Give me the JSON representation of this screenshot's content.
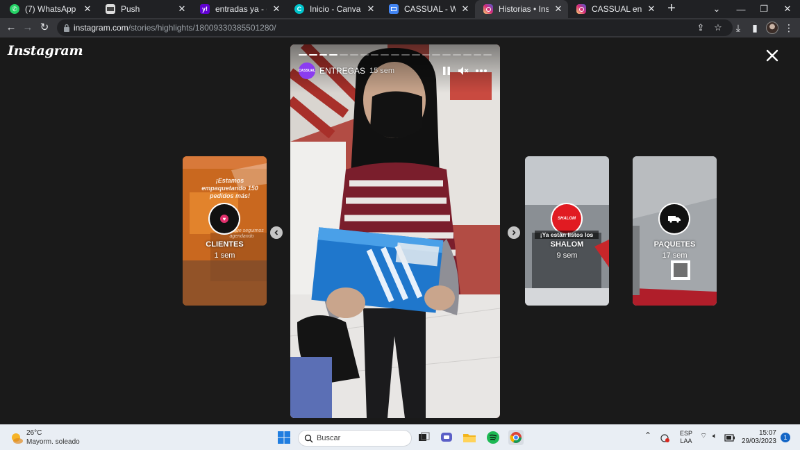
{
  "browser": {
    "tabs": [
      {
        "title": "(7) WhatsApp",
        "favicon_color": "#25d366",
        "favicon": "whatsapp-icon",
        "active": false
      },
      {
        "title": "Push",
        "favicon_color": "#eeeeee",
        "favicon": "push-icon",
        "active": false
      },
      {
        "title": "entradas ya - de búsq",
        "favicon_color": "#6001d2",
        "favicon": "yahoo-icon",
        "active": false
      },
      {
        "title": "Inicio - Canva",
        "favicon_color": "#00c4cc",
        "favicon": "canva-icon",
        "active": false
      },
      {
        "title": "CASSUAL - Website",
        "favicon_color": "#4285f4",
        "favicon": "website-icon",
        "active": false
      },
      {
        "title": "Historias • Instagram",
        "favicon_color": "#e1306c",
        "favicon": "instagram-icon",
        "active": true
      },
      {
        "title": "CASSUAL en Instagram",
        "favicon_color": "#e1306c",
        "favicon": "instagram-icon",
        "active": false
      }
    ],
    "url_host": "instagram.com",
    "url_path": "/stories/highlights/18009330385501280/"
  },
  "instagram": {
    "logo": "Instagram",
    "main_story": {
      "username": "ENTREGAS",
      "age": "15 sem",
      "avatar_text": "CASSUAL",
      "segments_total": 19,
      "segments_done": 4
    },
    "side_stories": [
      {
        "name": "CLIENTES",
        "age": "1 sem",
        "overlay": "¡Estamos empaquetando 150 pedidos más!",
        "overlay2": "orden que seguimos agendando",
        "icon": "heart-icon"
      },
      {
        "name": "SHALOM",
        "age": "9 sem",
        "overlay": "¡Ya están listos los",
        "badge": "SHALOM",
        "icon": "shalom-logo-icon"
      },
      {
        "name": "PAQUETES",
        "age": "17 sem",
        "icon": "truck-icon"
      }
    ]
  },
  "taskbar": {
    "temp": "26°C",
    "weather": "Mayorm. soleado",
    "search_placeholder": "Buscar",
    "lang": "ESP",
    "layout": "LAA",
    "time": "15:07",
    "date": "29/03/2023",
    "notifications": "1"
  }
}
